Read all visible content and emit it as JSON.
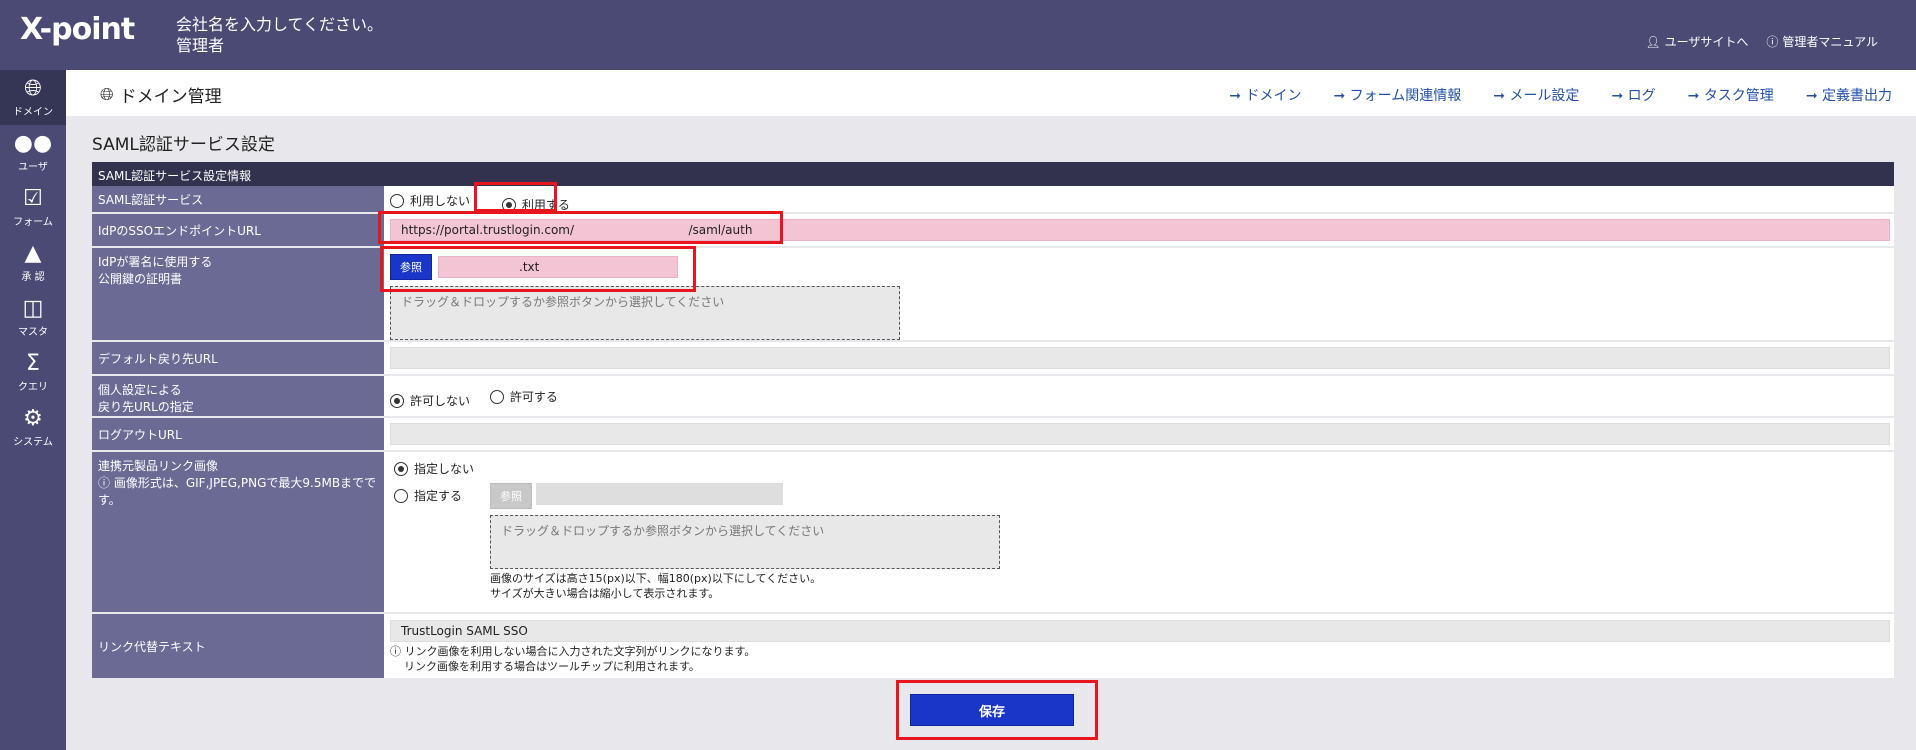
{
  "header": {
    "logo": "X-point",
    "company_line1": "会社名を入力してください。",
    "company_line2": "管理者",
    "user_site": "ユーザサイトへ",
    "admin_manual": "管理者マニュアル"
  },
  "sidenav": [
    {
      "label": "ドメイン",
      "icon": "globe-icon"
    },
    {
      "label": "ユーザ",
      "icon": "users-icon"
    },
    {
      "label": "フォーム",
      "icon": "form-icon"
    },
    {
      "label": "承 認",
      "icon": "stamp-icon"
    },
    {
      "label": "マスタ",
      "icon": "database-icon"
    },
    {
      "label": "クエリ",
      "icon": "sigma-icon"
    },
    {
      "label": "システム",
      "icon": "gear-icon"
    }
  ],
  "titlebar": {
    "title": "ドメイン管理",
    "links": [
      "ドメイン",
      "フォーム関連情報",
      "メール設定",
      "ログ",
      "タスク管理",
      "定義書出力"
    ]
  },
  "section_title": "SAML認証サービス設定",
  "form": {
    "head": "SAML認証サービス設定情報",
    "saml_service": {
      "label": "SAML認証サービス",
      "opt_off": "利用しない",
      "opt_on": "利用する"
    },
    "idp_url": {
      "label": "IdPのSSOエンドポイントURL",
      "value": "https://portal.trustlogin.com/                              /saml/auth"
    },
    "cert": {
      "label1": "IdPが署名に使用する",
      "label2": "公開鍵の証明書",
      "ref_button": "参照",
      "file": ".txt",
      "drop_text": "ドラッグ＆ドロップするか参照ボタンから選択してください"
    },
    "default_return": {
      "label": "デフォルト戻り先URL",
      "value": ""
    },
    "personal": {
      "label1": "個人設定による",
      "label2": "戻り先URLの指定",
      "opt_no": "許可しない",
      "opt_yes": "許可する"
    },
    "logout": {
      "label": "ログアウトURL",
      "value": ""
    },
    "link_image": {
      "label": "連携元製品リンク画像",
      "note": "画像形式は、GIF,JPEG,PNGで最大9.5MBまでです。",
      "opt_none": "指定しない",
      "opt_set": "指定する",
      "ref_button": "参照",
      "drop_text": "ドラッグ＆ドロップするか参照ボタンから選択してください",
      "size_note1": "画像のサイズは高さ15(px)以下、幅180(px)以下にしてください。",
      "size_note2": "サイズが大きい場合は縮小して表示されます。"
    },
    "link_text": {
      "label": "リンク代替テキスト",
      "value": "TrustLogin SAML SSO",
      "note1": "リンク画像を利用しない場合に入力された文字列がリンクになります。",
      "note2": "リンク画像を利用する場合はツールチップに利用されます。"
    }
  },
  "save_button": "保存",
  "colors": {
    "header": "#4a4a74",
    "label_bg": "#6a6a94",
    "accent": "#1a36c8",
    "highlight": "#e8141e",
    "pink": "#f2c4d4"
  }
}
